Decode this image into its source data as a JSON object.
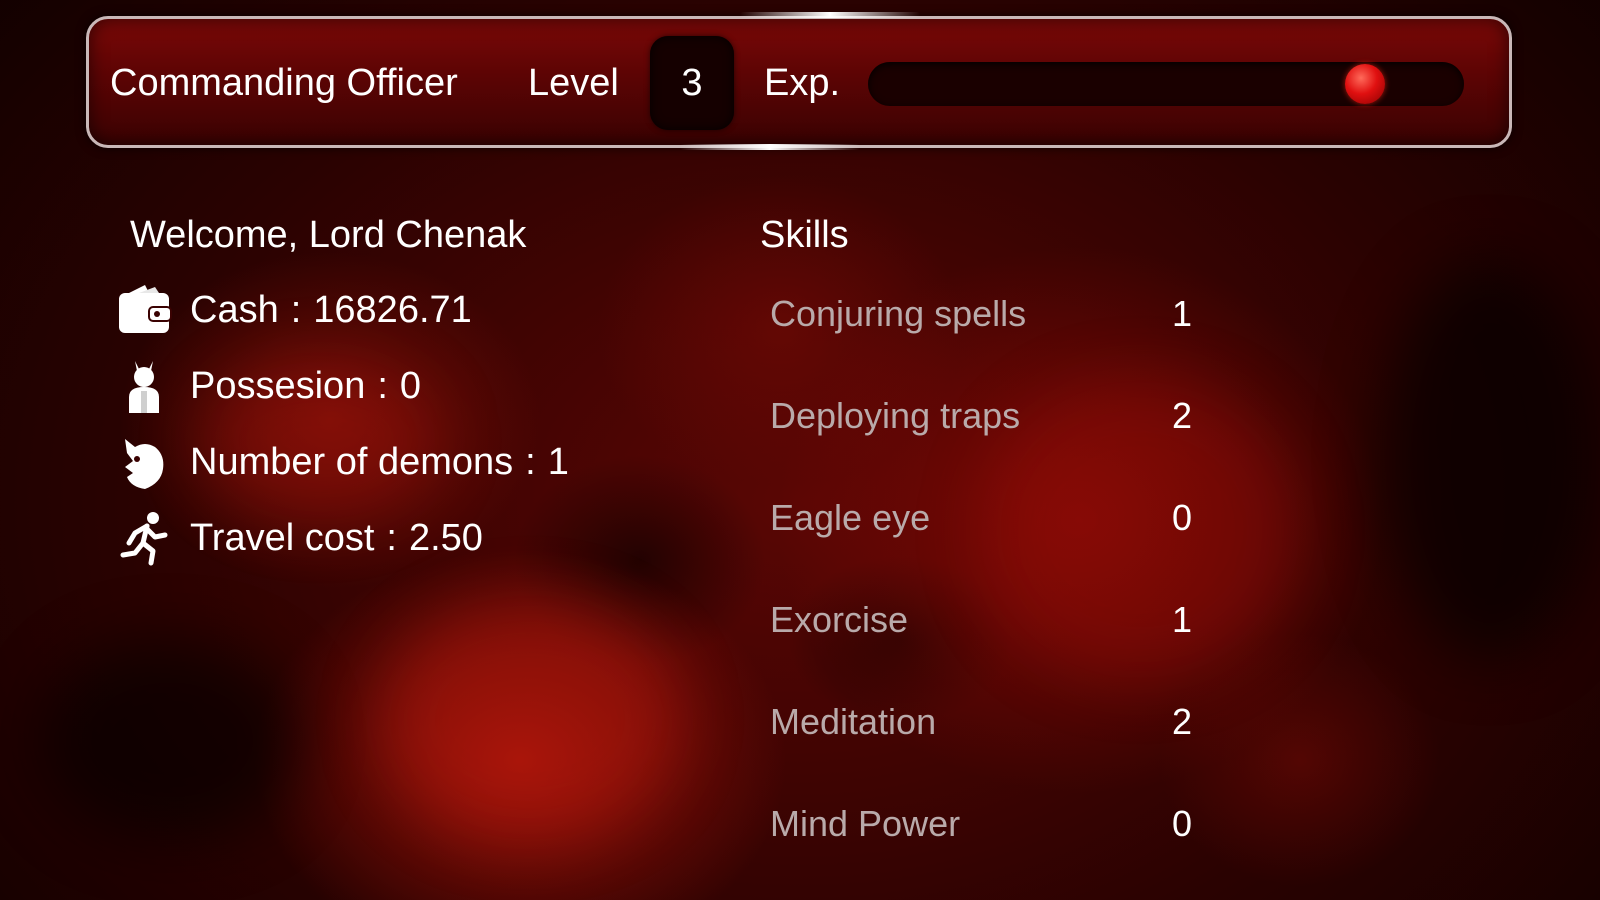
{
  "header": {
    "rank": "Commanding Officer",
    "level_label": "Level",
    "level_value": "3",
    "exp_label": "Exp.",
    "exp_fraction": 0.86
  },
  "player": {
    "welcome": "Welcome, Lord Chenak",
    "stats": [
      {
        "icon": "wallet-icon",
        "label": "Cash",
        "separator": ":",
        "value": "16826.71"
      },
      {
        "icon": "possessed-person-icon",
        "label": "Possesion",
        "separator": ":",
        "value": "0"
      },
      {
        "icon": "demon-head-icon",
        "label": "Number of demons",
        "separator": ":",
        "value": "1"
      },
      {
        "icon": "running-man-icon",
        "label": "Travel cost",
        "separator": ":",
        "value": "2.50"
      }
    ]
  },
  "skills": {
    "title": "Skills",
    "items": [
      {
        "name": "Conjuring spells",
        "value": "1"
      },
      {
        "name": "Deploying traps",
        "value": "2"
      },
      {
        "name": "Eagle eye",
        "value": "0"
      },
      {
        "name": "Exorcise",
        "value": "1"
      },
      {
        "name": "Meditation",
        "value": "2"
      },
      {
        "name": "Mind Power",
        "value": "0"
      }
    ]
  },
  "colors": {
    "background": "#3a0202",
    "header_border": "#c9b8b8",
    "exp_knob": "#e01010",
    "skill_name": "#b9aaaa",
    "text": "#ffffff"
  }
}
